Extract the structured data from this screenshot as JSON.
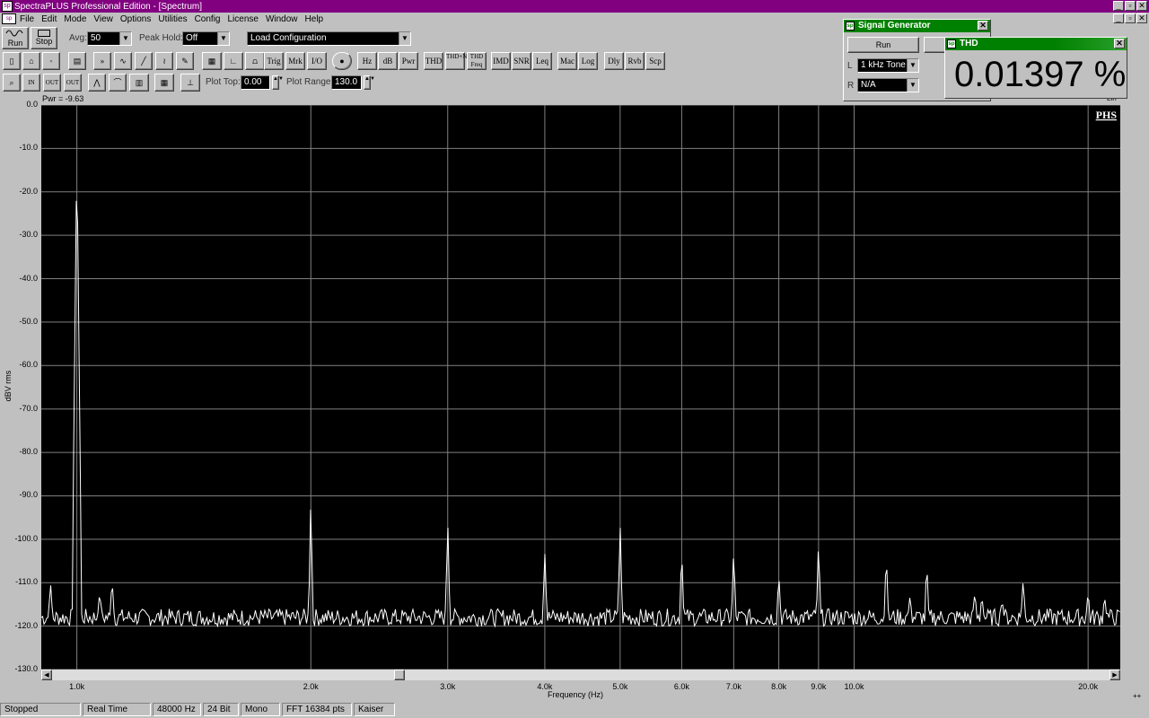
{
  "app": {
    "title": "SpectraPLUS Professional Edition - [Spectrum]",
    "icon": "app-icon"
  },
  "window_controls": [
    "_",
    "▫",
    "✕"
  ],
  "menu": [
    "File",
    "Edit",
    "Mode",
    "View",
    "Options",
    "Utilities",
    "Config",
    "License",
    "Window",
    "Help"
  ],
  "toolbar1": {
    "run_label": "Run",
    "stop_label": "Stop",
    "avg_label": "Avg:",
    "avg_value": "50",
    "peak_hold_label": "Peak Hold:",
    "peak_hold_value": "Off",
    "config_value": "Load Configuration"
  },
  "toolbar2_buttons": [
    "Trig",
    "Mrk",
    "I/O",
    "Hz",
    "dB",
    "Pwr",
    "THD",
    "THD+N",
    "THD Freq",
    "IMD",
    "SNR",
    "Leq",
    "Mac",
    "Log",
    "Dly",
    "Rvb",
    "Scp"
  ],
  "toolbar3": {
    "plot_top_label": "Plot Top:",
    "plot_top_value": "0.00",
    "plot_range_label": "Plot Range:",
    "plot_range_value": "130.0"
  },
  "plot": {
    "readout": "Pwr = -9.63",
    "watermark": "PHS",
    "background": "#000000",
    "trace_color": "#ffffff",
    "grid_color": "#808080"
  },
  "chart_data": {
    "type": "line",
    "xlabel": "Frequency (Hz)",
    "ylabel": "dBV rms",
    "x_scale": "log",
    "xlim": [
      900,
      22000
    ],
    "ylim": [
      -130,
      0
    ],
    "y_ticks": [
      "0.0",
      "-10.0",
      "-20.0",
      "-30.0",
      "-40.0",
      "-50.0",
      "-60.0",
      "-70.0",
      "-80.0",
      "-90.0",
      "-100.0",
      "-110.0",
      "-120.0",
      "-130.0"
    ],
    "x_ticks": [
      {
        "value": 1000,
        "label": "1.0k"
      },
      {
        "value": 2000,
        "label": "2.0k"
      },
      {
        "value": 3000,
        "label": "3.0k"
      },
      {
        "value": 4000,
        "label": "4.0k"
      },
      {
        "value": 5000,
        "label": "5.0k"
      },
      {
        "value": 6000,
        "label": "6.0k"
      },
      {
        "value": 7000,
        "label": "7.0k"
      },
      {
        "value": 8000,
        "label": "8.0k"
      },
      {
        "value": 9000,
        "label": "9.0k"
      },
      {
        "value": 10000,
        "label": "10.0k"
      },
      {
        "value": 20000,
        "label": "20.0k"
      }
    ],
    "noise_floor_db": -118,
    "peaks": [
      {
        "freq": 925,
        "db": -110
      },
      {
        "freq": 1000,
        "db": -10
      },
      {
        "freq": 1070,
        "db": -112
      },
      {
        "freq": 1110,
        "db": -109
      },
      {
        "freq": 2000,
        "db": -90
      },
      {
        "freq": 3000,
        "db": -95
      },
      {
        "freq": 4000,
        "db": -103
      },
      {
        "freq": 5000,
        "db": -96
      },
      {
        "freq": 6000,
        "db": -102
      },
      {
        "freq": 7000,
        "db": -102
      },
      {
        "freq": 8000,
        "db": -108
      },
      {
        "freq": 9000,
        "db": -100
      },
      {
        "freq": 11000,
        "db": -103
      },
      {
        "freq": 11800,
        "db": -113
      },
      {
        "freq": 12400,
        "db": -105
      },
      {
        "freq": 14300,
        "db": -112
      },
      {
        "freq": 14600,
        "db": -113
      },
      {
        "freq": 15500,
        "db": -114
      },
      {
        "freq": 16500,
        "db": -109
      },
      {
        "freq": 20000,
        "db": -112
      },
      {
        "freq": 21000,
        "db": -113
      }
    ]
  },
  "status_bar": [
    "Stopped",
    "Real Time",
    "48000 Hz",
    "24 Bit",
    "Mono",
    "FFT 16384 pts",
    "Kaiser"
  ],
  "signal_generator": {
    "title": "Signal Generator",
    "run_label": "Run",
    "left_label": "L",
    "left_value": "1 kHz Tone",
    "right_label": "R",
    "right_value": "N/A"
  },
  "thd_meter": {
    "title": "THD",
    "value": "0.01397 %"
  }
}
